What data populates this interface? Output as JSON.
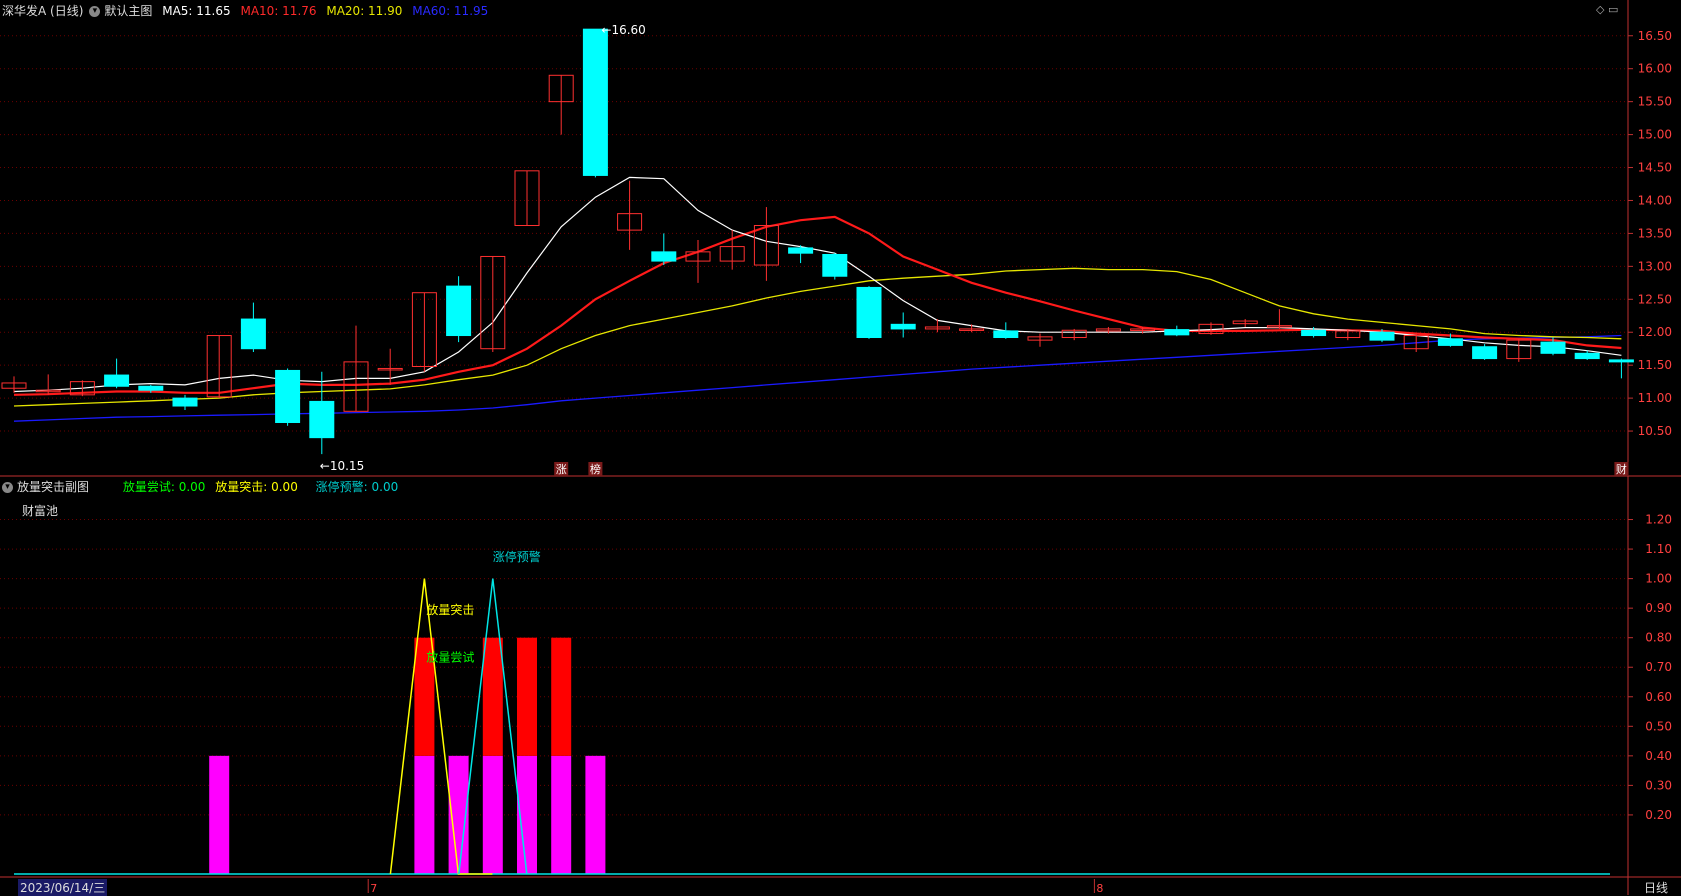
{
  "header": {
    "stock": "深华发A (日线)",
    "main_chart": "默认主图",
    "ma5_label": "MA5: 11.65",
    "ma10_label": "MA10: 11.76",
    "ma20_label": "MA20: 11.90",
    "ma60_label": "MA60: 11.95"
  },
  "sub_header": {
    "title": "放量突击副图",
    "v1": "放量尝试: 0.00",
    "v2": "放量突击: 0.00",
    "v3": "涨停预警: 0.00"
  },
  "pool_label": "财富池",
  "period_label": "日线",
  "date_label": "2023/06/14/三",
  "colors": {
    "up": "#ff3030",
    "down": "#00ffff",
    "ma5": "#ffffff",
    "ma10": "#ff1a1a",
    "ma20": "#e6e600",
    "ma60": "#1a1aff",
    "grid": "#6b0000",
    "axis": "#c03030",
    "magenta": "#ff00ff",
    "yellow": "#ffff00",
    "cyan": "#00e6e6",
    "green": "#00ff00"
  },
  "chart_data": [
    {
      "type": "candlestick",
      "ylim": [
        10.0,
        16.8
      ],
      "yticks": [
        "10.50",
        "11.00",
        "11.50",
        "12.00",
        "12.50",
        "13.00",
        "13.50",
        "14.00",
        "14.50",
        "15.00",
        "15.50",
        "16.00",
        "16.50"
      ],
      "candles": [
        [
          11.15,
          11.23,
          11.08,
          11.33
        ],
        [
          11.12,
          11.12,
          11.05,
          11.36
        ],
        [
          11.05,
          11.25,
          11.03,
          11.27
        ],
        [
          11.35,
          11.18,
          11.15,
          11.6
        ],
        [
          11.18,
          11.12,
          11.08,
          11.2
        ],
        [
          11.0,
          10.88,
          10.82,
          11.05
        ],
        [
          11.02,
          11.95,
          11.0,
          11.95
        ],
        [
          12.2,
          11.75,
          11.7,
          12.45
        ],
        [
          11.42,
          10.63,
          10.58,
          11.45
        ],
        [
          10.95,
          10.4,
          10.15,
          11.4
        ],
        [
          10.8,
          11.55,
          10.8,
          12.1
        ],
        [
          11.45,
          11.45,
          11.2,
          11.75
        ],
        [
          11.48,
          12.6,
          11.4,
          12.6
        ],
        [
          12.7,
          11.95,
          11.85,
          12.85
        ],
        [
          11.75,
          13.15,
          11.7,
          13.15
        ],
        [
          13.62,
          14.45,
          13.62,
          14.45
        ],
        [
          15.5,
          15.9,
          15.0,
          15.9
        ],
        [
          16.6,
          14.38,
          14.35,
          16.6
        ],
        [
          13.55,
          13.8,
          13.25,
          14.3
        ],
        [
          13.22,
          13.08,
          13.02,
          13.5
        ],
        [
          13.08,
          13.22,
          12.75,
          13.4
        ],
        [
          13.08,
          13.3,
          12.95,
          13.55
        ],
        [
          13.02,
          13.62,
          12.78,
          13.9
        ],
        [
          13.28,
          13.2,
          13.05,
          13.32
        ],
        [
          13.18,
          12.85,
          12.8,
          13.2
        ],
        [
          12.68,
          11.92,
          11.9,
          12.7
        ],
        [
          12.12,
          12.05,
          11.92,
          12.3
        ],
        [
          12.05,
          12.08,
          12.0,
          12.2
        ],
        [
          12.05,
          12.05,
          12.0,
          12.12
        ],
        [
          12.02,
          11.92,
          11.9,
          12.15
        ],
        [
          11.88,
          11.93,
          11.78,
          11.98
        ],
        [
          11.92,
          12.03,
          11.88,
          12.05
        ],
        [
          12.02,
          12.05,
          11.98,
          12.08
        ],
        [
          12.04,
          12.05,
          11.98,
          12.08
        ],
        [
          12.04,
          11.96,
          11.94,
          12.1
        ],
        [
          11.98,
          12.12,
          11.96,
          12.15
        ],
        [
          12.13,
          12.17,
          12.08,
          12.2
        ],
        [
          12.08,
          12.1,
          12.05,
          12.35
        ],
        [
          12.03,
          11.95,
          11.92,
          12.08
        ],
        [
          11.92,
          12.02,
          11.88,
          12.05
        ],
        [
          12.0,
          11.88,
          11.85,
          12.05
        ],
        [
          11.75,
          11.95,
          11.7,
          11.98
        ],
        [
          11.9,
          11.8,
          11.78,
          11.98
        ],
        [
          11.78,
          11.6,
          11.58,
          11.82
        ],
        [
          11.6,
          11.88,
          11.55,
          11.9
        ],
        [
          11.85,
          11.68,
          11.65,
          11.92
        ],
        [
          11.68,
          11.6,
          11.58,
          11.72
        ],
        [
          11.58,
          11.55,
          11.3,
          11.6
        ]
      ],
      "ma5": [
        11.1,
        11.12,
        11.15,
        11.2,
        11.22,
        11.2,
        11.3,
        11.35,
        11.27,
        11.25,
        11.3,
        11.3,
        11.4,
        11.7,
        12.15,
        12.9,
        13.6,
        14.05,
        14.35,
        14.33,
        13.85,
        13.55,
        13.38,
        13.3,
        13.2,
        12.85,
        12.48,
        12.18,
        12.1,
        12.02,
        12.0,
        12.0,
        12.0,
        12.0,
        12.02,
        12.04,
        12.07,
        12.07,
        12.05,
        12.03,
        12.0,
        11.95,
        11.9,
        11.84,
        11.8,
        11.78,
        11.72,
        11.65
      ],
      "ma10": [
        11.05,
        11.06,
        11.08,
        11.1,
        11.1,
        11.08,
        11.08,
        11.15,
        11.22,
        11.2,
        11.2,
        11.22,
        11.28,
        11.4,
        11.5,
        11.75,
        12.1,
        12.5,
        12.78,
        13.05,
        13.22,
        13.42,
        13.6,
        13.7,
        13.75,
        13.5,
        13.15,
        12.95,
        12.75,
        12.6,
        12.47,
        12.33,
        12.2,
        12.07,
        12.02,
        12.02,
        12.02,
        12.03,
        12.04,
        12.03,
        12.02,
        11.98,
        11.95,
        11.92,
        11.9,
        11.88,
        11.8,
        11.76
      ],
      "ma20": [
        10.88,
        10.9,
        10.92,
        10.94,
        10.96,
        10.98,
        11.0,
        11.05,
        11.08,
        11.1,
        11.12,
        11.14,
        11.2,
        11.28,
        11.35,
        11.5,
        11.75,
        11.95,
        12.1,
        12.2,
        12.3,
        12.4,
        12.52,
        12.62,
        12.7,
        12.78,
        12.82,
        12.85,
        12.88,
        12.93,
        12.95,
        12.97,
        12.95,
        12.95,
        12.92,
        12.8,
        12.6,
        12.4,
        12.28,
        12.2,
        12.15,
        12.1,
        12.05,
        11.98,
        11.95,
        11.93,
        11.92,
        11.9
      ],
      "ma60": [
        10.65,
        10.67,
        10.69,
        10.71,
        10.72,
        10.73,
        10.74,
        10.75,
        10.76,
        10.77,
        10.78,
        10.79,
        10.8,
        10.82,
        10.85,
        10.9,
        10.96,
        11.0,
        11.04,
        11.08,
        11.12,
        11.16,
        11.2,
        11.24,
        11.28,
        11.32,
        11.36,
        11.4,
        11.44,
        11.47,
        11.5,
        11.53,
        11.56,
        11.59,
        11.62,
        11.65,
        11.68,
        11.71,
        11.74,
        11.77,
        11.8,
        11.84,
        11.88,
        11.9,
        11.91,
        11.92,
        11.93,
        11.95
      ],
      "annotations": [
        {
          "bar": 17,
          "text": "16.60"
        },
        {
          "bar": 9,
          "text": "10.15"
        }
      ],
      "markers": [
        {
          "bar": 16,
          "text": "涨"
        },
        {
          "bar": 17,
          "text": "榜"
        },
        {
          "bar": 47,
          "text": "财"
        }
      ]
    },
    {
      "type": "bar",
      "ylim": [
        0,
        1.3
      ],
      "yticks": [
        "0.20",
        "0.30",
        "0.40",
        "0.50",
        "0.60",
        "0.70",
        "0.80",
        "0.90",
        "1.00",
        "1.10",
        "1.20"
      ],
      "magenta_bars": [
        {
          "bar": 6,
          "value": 0.4
        },
        {
          "bar": 12,
          "value": 0.4
        },
        {
          "bar": 13,
          "value": 0.4
        },
        {
          "bar": 14,
          "value": 0.4
        },
        {
          "bar": 15,
          "value": 0.4
        },
        {
          "bar": 16,
          "value": 0.4
        },
        {
          "bar": 17,
          "value": 0.4
        }
      ],
      "red_bars": [
        {
          "bar": 12,
          "value": 0.8
        },
        {
          "bar": 14,
          "value": 0.8
        },
        {
          "bar": 15,
          "value": 0.8
        },
        {
          "bar": 16,
          "value": 0.8
        }
      ],
      "yellow_spike": {
        "bar": 12,
        "peak": 1.0,
        "label": "放量突击"
      },
      "cyan_spike": {
        "bar": 14,
        "peak": 1.0,
        "label": "涨停预警"
      },
      "green_label": {
        "bar": 12,
        "text": "放量尝试"
      },
      "x_markers": [
        "7",
        "8"
      ]
    }
  ]
}
